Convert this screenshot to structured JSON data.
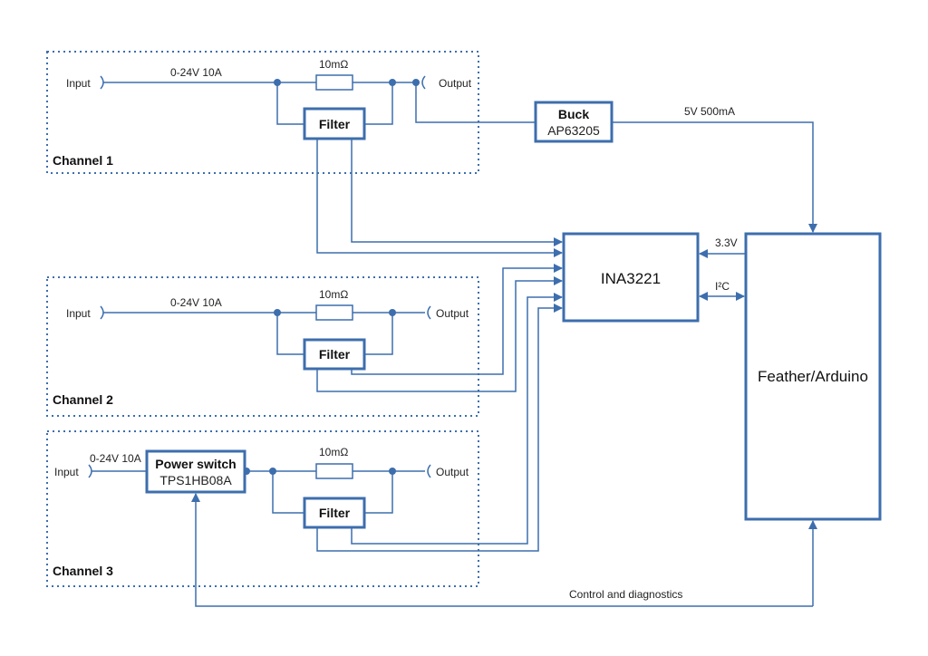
{
  "channels": [
    {
      "label": "Channel 1",
      "input": "Input",
      "output": "Output",
      "rating": "0-24V 10A",
      "shunt": "10mΩ",
      "filter": "Filter"
    },
    {
      "label": "Channel 2",
      "input": "Input",
      "output": "Output",
      "rating": "0-24V 10A",
      "shunt": "10mΩ",
      "filter": "Filter"
    },
    {
      "label": "Channel 3",
      "input": "Input",
      "output": "Output",
      "rating": "0-24V 10A",
      "shunt": "10mΩ",
      "filter": "Filter"
    }
  ],
  "power_switch": {
    "title": "Power switch",
    "part": "TPS1HB08A"
  },
  "buck": {
    "title": "Buck",
    "part": "AP63205",
    "output": "5V 500mA"
  },
  "ina": {
    "label": "INA3221"
  },
  "mcu": {
    "label": "Feather/Arduino"
  },
  "links": {
    "supply": "3.3V",
    "bus": "I²C",
    "control": "Control and diagnostics"
  },
  "color": "#3d6ead"
}
